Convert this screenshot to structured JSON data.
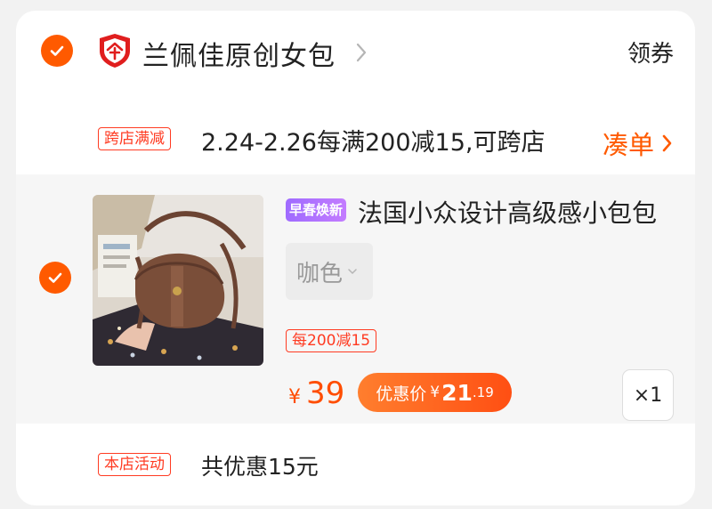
{
  "colors": {
    "accent": "#ff5a00",
    "tag_red": "#ff3b22",
    "season_purple": "#a86eff"
  },
  "shop": {
    "name": "兰佩佳原创女包",
    "coupon_label": "领券",
    "icon": "shop-shield-icon"
  },
  "promo": {
    "tag": "跨店满减",
    "text": "2.24-2.26每满200减15,可跨店",
    "action_label": "凑单"
  },
  "item": {
    "season_tag": "早春焕新",
    "title": "法国小众设计高级感小包包",
    "sku": "咖色",
    "discount_tag": "每200减15",
    "price_symbol": "¥",
    "price": "39",
    "deal_label": "优惠价",
    "deal_symbol": "¥",
    "deal_int": "21",
    "deal_dec": ".19",
    "quantity": "×1",
    "selected": true
  },
  "activity": {
    "tag": "本店活动",
    "text": "共优惠15元"
  }
}
